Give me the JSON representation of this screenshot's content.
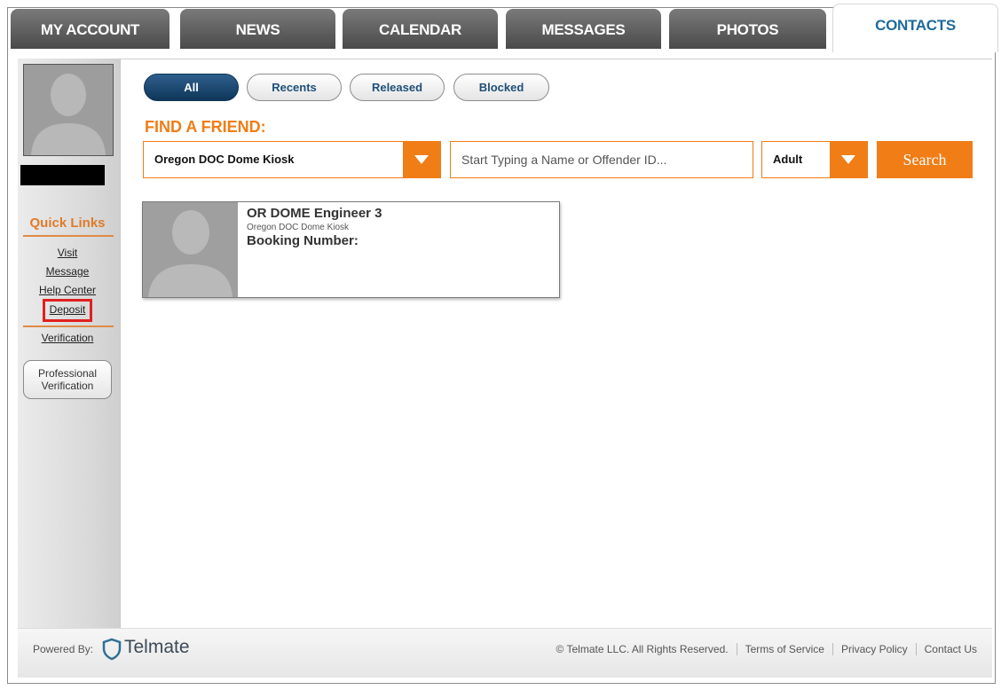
{
  "tabs": [
    {
      "label": "MY ACCOUNT",
      "active": false
    },
    {
      "label": "NEWS",
      "active": false
    },
    {
      "label": "CALENDAR",
      "active": false
    },
    {
      "label": "MESSAGES",
      "active": false
    },
    {
      "label": "PHOTOS",
      "active": false
    },
    {
      "label": "CONTACTS",
      "active": true
    }
  ],
  "sidebar": {
    "quick_links_title": "Quick Links",
    "links": [
      "Visit",
      "Message",
      "Help Center",
      "Deposit",
      "Verification"
    ],
    "professional_button": "Professional Verification"
  },
  "filters": [
    "All",
    "Recents",
    "Released",
    "Blocked"
  ],
  "find_friend": {
    "title": "FIND A FRIEND:",
    "facility": "Oregon DOC Dome Kiosk",
    "search_placeholder": "Start Typing a Name or Offender ID...",
    "age_group": "Adult",
    "search_label": "Search"
  },
  "contact": {
    "name": "OR DOME Engineer 3",
    "facility": "Oregon DOC Dome Kiosk",
    "booking_label": "Booking Number:"
  },
  "footer": {
    "powered_by": "Powered By:",
    "brand": "Telmate",
    "copyright": "© Telmate LLC. All Rights Reserved.",
    "links": [
      "Terms of Service",
      "Privacy Policy",
      "Contact Us"
    ]
  },
  "colors": {
    "accent": "#f07d16",
    "tab_active_text": "#1e6b9c",
    "pill_active": "#0f3658"
  }
}
